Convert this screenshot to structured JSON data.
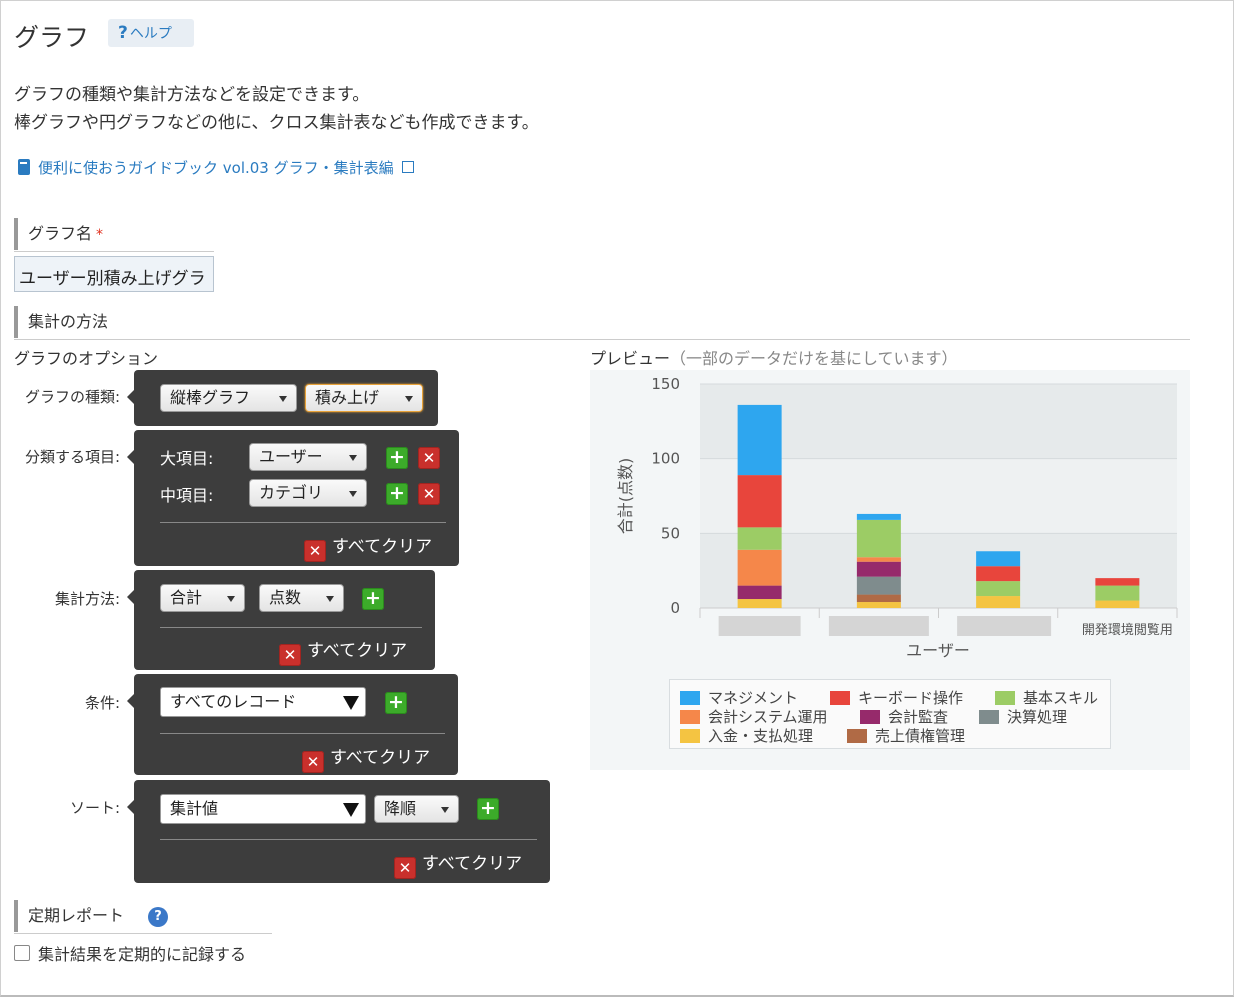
{
  "header": {
    "title": "グラフ",
    "help_label": "ヘルプ",
    "help_mark": "?"
  },
  "description": {
    "line1": "グラフの種類や集計方法などを設定できます。",
    "line2": "棒グラフや円グラフなどの他に、クロス集計表なども作成できます。"
  },
  "guide_link": "便利に使おうガイドブック vol.03 グラフ・集計表編",
  "graph_name": {
    "label": "グラフ名",
    "required_mark": "*",
    "value": "ユーザー別積み上げグラ"
  },
  "aggregation_section": "集計の方法",
  "options": {
    "title": "グラフのオプション",
    "graph_type": {
      "label": "グラフの種類:",
      "type": "縦棒グラフ",
      "mode": "積み上げ"
    },
    "group_by": {
      "label": "分類する項目:",
      "major_label": "大項目:",
      "major_value": "ユーザー",
      "minor_label": "中項目:",
      "minor_value": "カテゴリ",
      "clear_all": "すべてクリア"
    },
    "aggregation": {
      "label": "集計方法:",
      "func": "合計",
      "field": "点数",
      "clear_all": "すべてクリア"
    },
    "conditions": {
      "label": "条件:",
      "value": "すべてのレコード",
      "clear_all": "すべてクリア"
    },
    "sort": {
      "label": "ソート:",
      "by": "集計値",
      "order": "降順",
      "clear_all": "すべてクリア"
    }
  },
  "preview": {
    "title": "プレビュー",
    "subtitle": "（一部のデータだけを基にしています）"
  },
  "chart_data": {
    "type": "bar",
    "stacked": true,
    "ylabel": "合計(点数)",
    "xlabel": "ユーザー",
    "ylim": [
      0,
      150
    ],
    "yticks": [
      0,
      50,
      100,
      150
    ],
    "categories": [
      "",
      "",
      "",
      "開発環境閲覧用"
    ],
    "series": [
      {
        "name": "入金・支払処理",
        "color": "#f4c442",
        "values": [
          6,
          4,
          8,
          5
        ]
      },
      {
        "name": "売上債権管理",
        "color": "#b06a45",
        "values": [
          0,
          5,
          0,
          0
        ]
      },
      {
        "name": "決算処理",
        "color": "#7f8c8d",
        "values": [
          0,
          12,
          0,
          0
        ]
      },
      {
        "name": "会計監査",
        "color": "#962a6b",
        "values": [
          9,
          10,
          0,
          0
        ]
      },
      {
        "name": "会計システム運用",
        "color": "#f5874a",
        "values": [
          24,
          3,
          0,
          0
        ]
      },
      {
        "name": "基本スキル",
        "color": "#9ccc65",
        "values": [
          15,
          25,
          10,
          10
        ]
      },
      {
        "name": "キーボード操作",
        "color": "#e8453c",
        "values": [
          35,
          0,
          10,
          5
        ]
      },
      {
        "name": "マネジメント",
        "color": "#2ea6ef",
        "values": [
          47,
          4,
          10,
          0
        ]
      }
    ],
    "legend_order": [
      "マネジメント",
      "キーボード操作",
      "基本スキル",
      "会計システム運用",
      "会計監査",
      "決算処理",
      "入金・支払処理",
      "売上債権管理"
    ]
  },
  "report": {
    "title": "定期レポート",
    "help_mark": "?",
    "checkbox_label": "集計結果を定期的に記録する"
  }
}
